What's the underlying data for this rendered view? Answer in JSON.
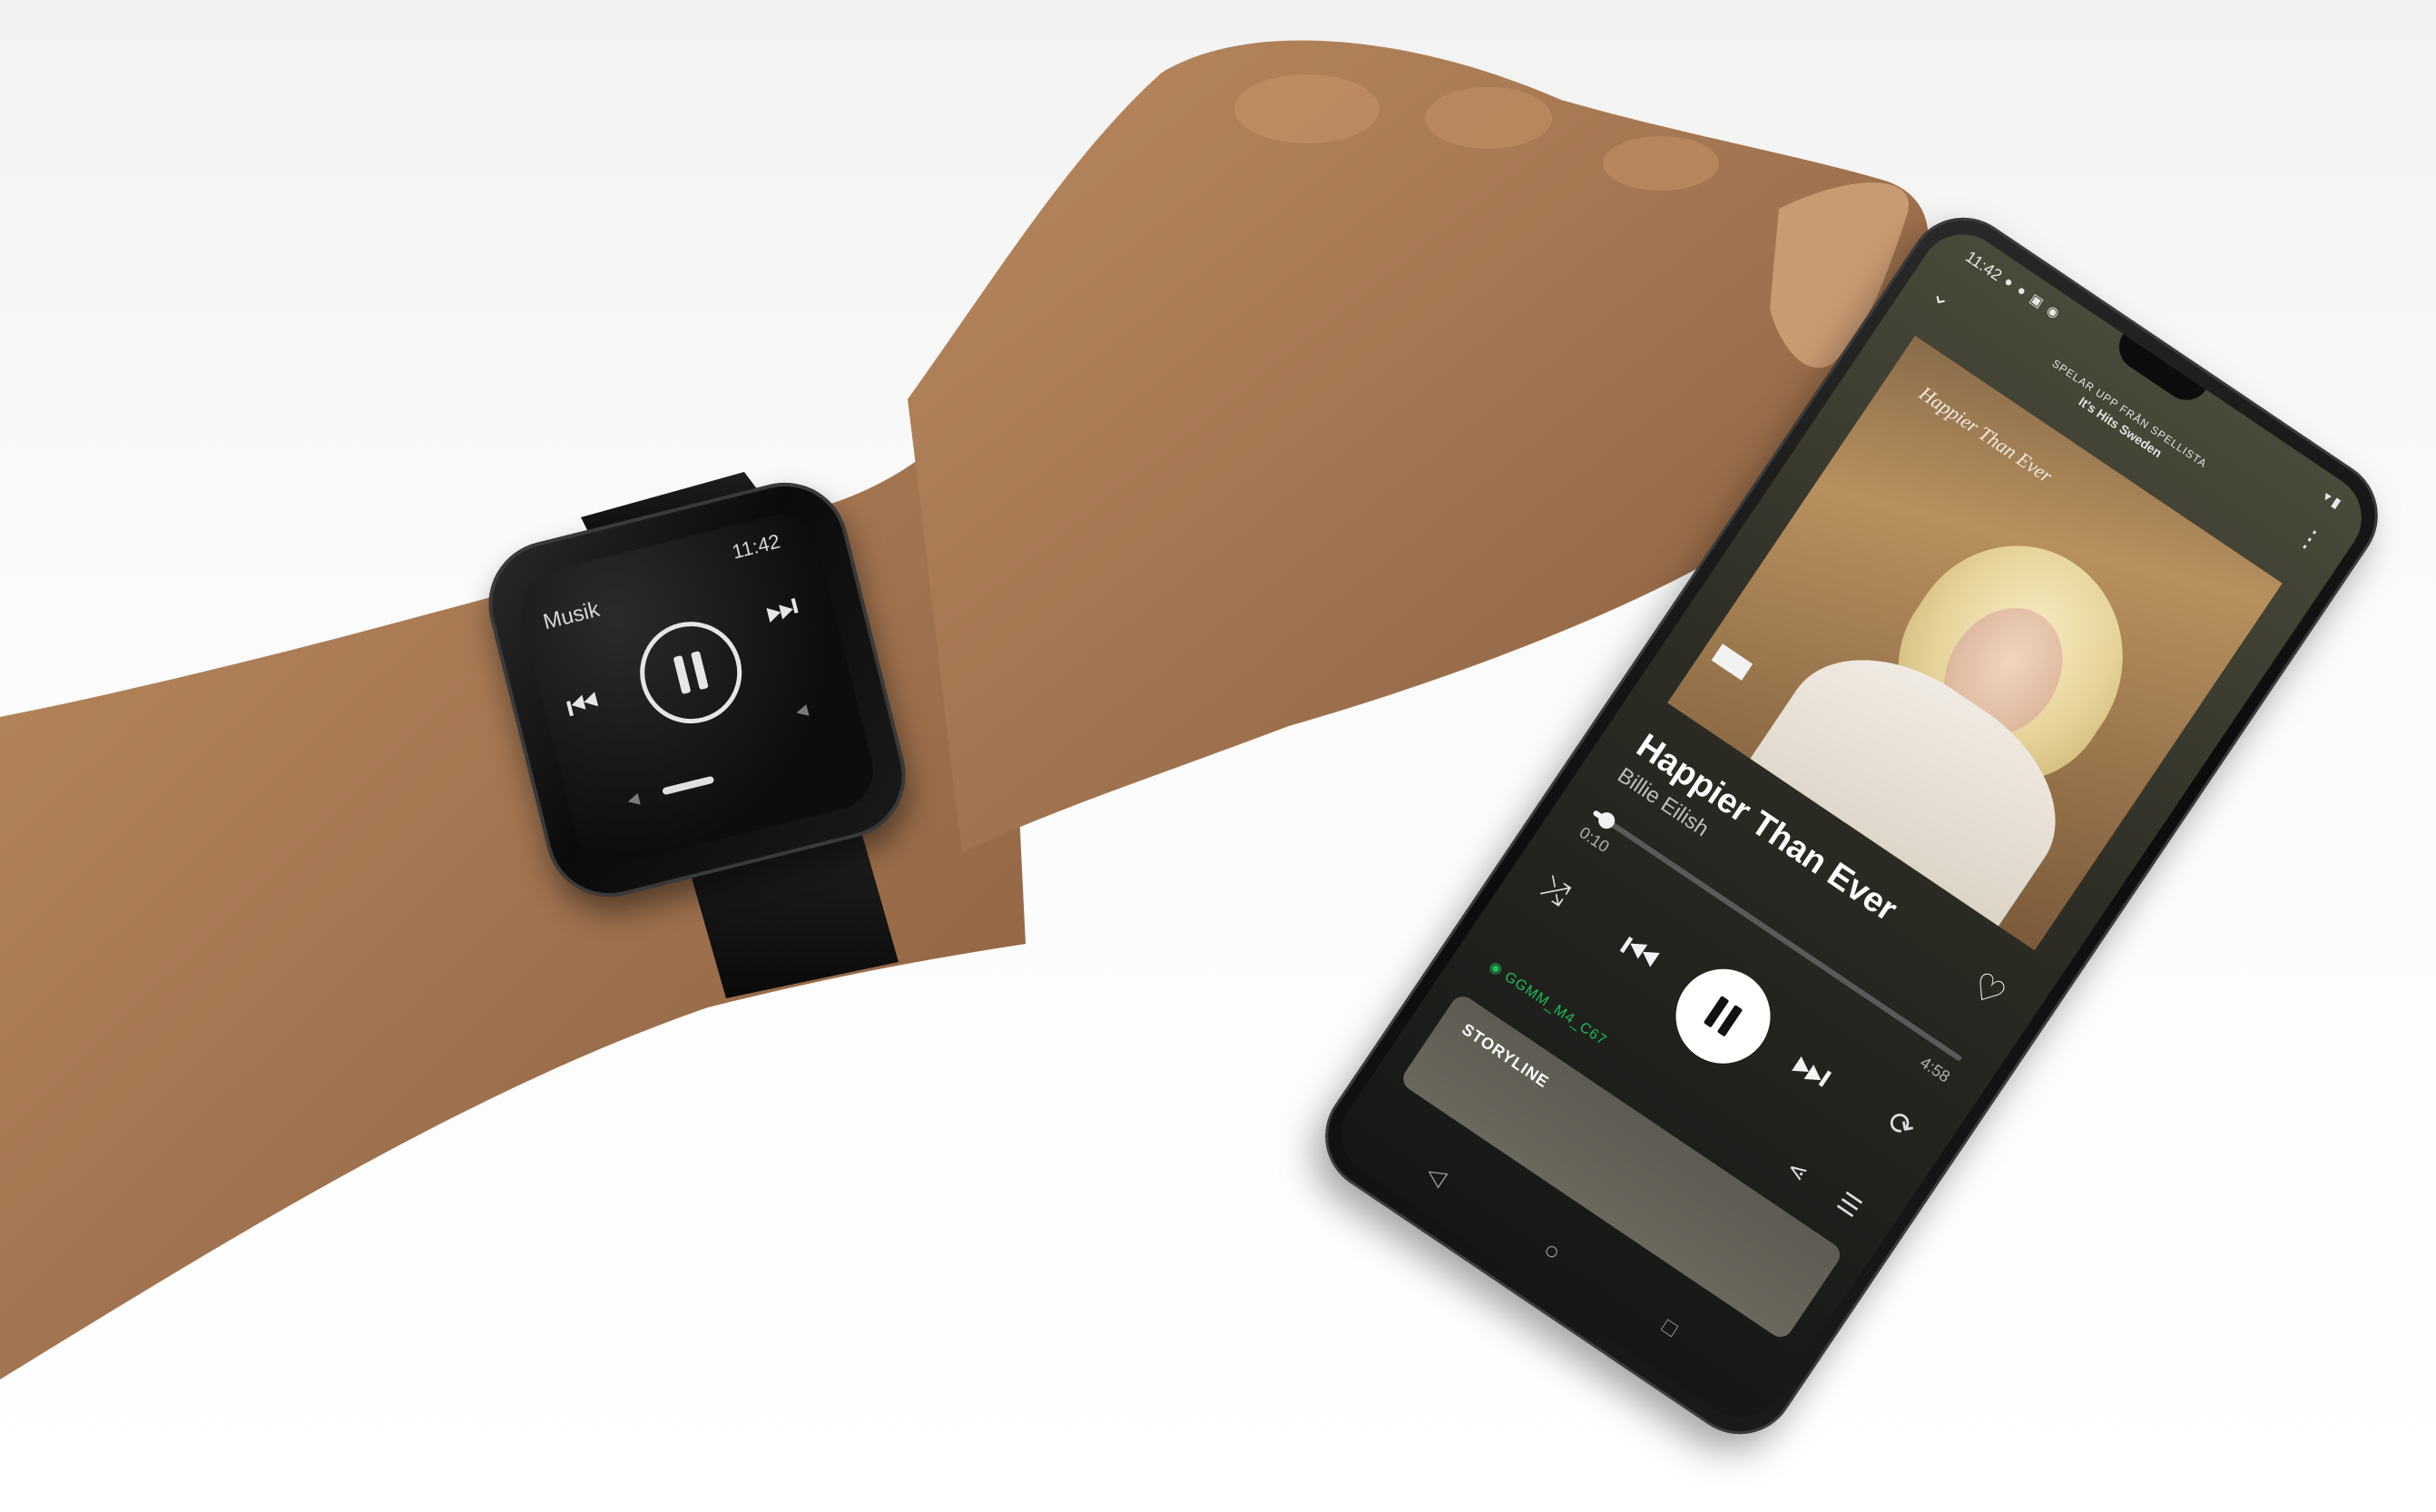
{
  "watch": {
    "title": "Musik",
    "time": "11:42",
    "icons": {
      "prev": "skip-previous-icon",
      "next": "skip-next-icon",
      "pause": "pause-icon",
      "vol_down": "volume-down-icon",
      "vol_up": "volume-up-icon"
    }
  },
  "phone": {
    "status": {
      "time": "11:42"
    },
    "header": {
      "playing_from": "SPELAR UPP FRÅN SPELLISTA",
      "playlist": "It's Hits Sweden"
    },
    "art": {
      "script_text": "Happier Than Ever"
    },
    "track": {
      "title": "Happier Than Ever",
      "artist": "Billie Eilish"
    },
    "progress": {
      "elapsed": "0:10",
      "total": "4:58",
      "fraction": 0.034
    },
    "device": {
      "name": "GGMM_M4_C67"
    },
    "storyline": {
      "label": "STORYLINE"
    },
    "icons": {
      "collapse": "chevron-down-icon",
      "more": "more-vertical-icon",
      "like": "heart-icon",
      "shuffle": "shuffle-icon",
      "prev": "skip-previous-icon",
      "play_pause": "pause-icon",
      "next": "skip-next-icon",
      "repeat": "repeat-icon",
      "share": "share-icon",
      "queue": "queue-icon",
      "device": "speaker-icon"
    }
  },
  "colors": {
    "spotify_green": "#1db954",
    "background": "#ffffff",
    "skin": "#a67a52"
  }
}
